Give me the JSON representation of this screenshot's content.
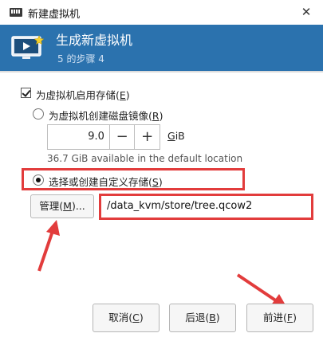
{
  "window": {
    "title": "新建虚拟机",
    "close_glyph": "✕"
  },
  "banner": {
    "title": "生成新虚拟机",
    "step": "5 的步骤 4",
    "icon": "monitor-play-icon"
  },
  "storage": {
    "enable_label": "为虚拟机启用存储(",
    "enable_key": "E",
    "enable_checked": true,
    "create_disk_label": "为虚拟机创建磁盘镜像(",
    "create_disk_key": "R",
    "disk_size": "9.0",
    "minus_glyph": "−",
    "plus_glyph": "+",
    "unit_key": "G",
    "unit_rest": "iB",
    "available_text": "36.7 GiB available in the default location",
    "custom_label": "选择或创建自定义存储(",
    "custom_key": "S",
    "custom_selected": true,
    "manage_label": "管理(",
    "manage_key": "M",
    "manage_suffix": ")...",
    "path_value": "/data_kvm/store/tree.qcow2"
  },
  "buttons": {
    "cancel_label": "取消(",
    "cancel_key": "C",
    "back_label": "后退(",
    "back_key": "B",
    "forward_label": "前进(",
    "forward_key": "F",
    "close_paren": ")"
  },
  "colors": {
    "banner": "#2b72ae",
    "annotation": "#e23c3c"
  }
}
